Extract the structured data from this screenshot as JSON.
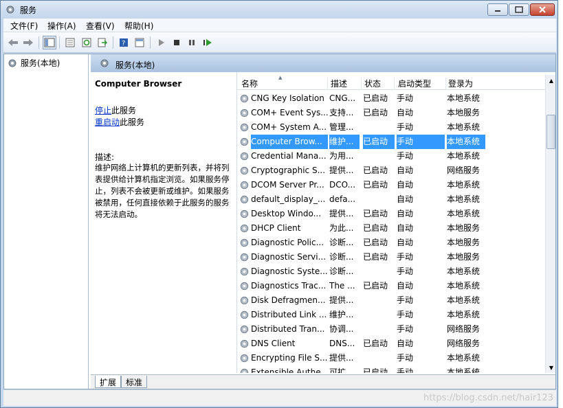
{
  "window": {
    "title": "服务"
  },
  "menu": {
    "items": [
      "文件(F)",
      "操作(A)",
      "查看(V)",
      "帮助(H)"
    ]
  },
  "tree": {
    "item": "服务(本地)"
  },
  "pane": {
    "header": "服务(本地)"
  },
  "detail": {
    "service_title": "Computer Browser",
    "stop_link": "停止",
    "stop_suffix": "此服务",
    "restart_link": "重启动",
    "restart_suffix": "此服务",
    "desc_label": "描述:",
    "desc_text": "维护网络上计算机的更新列表，并将列表提供给计算机指定浏览。如果服务停止，列表不会被更新或维护。如果服务被禁用，任何直接依赖于此服务的服务将无法启动。"
  },
  "columns": {
    "name": "名称",
    "desc": "描述",
    "state": "状态",
    "startup": "启动类型",
    "logon": "登录为"
  },
  "services": [
    {
      "name": "CNG Key Isolation",
      "desc": "CNG...",
      "state": "已启动",
      "startup": "手动",
      "logon": "本地系统"
    },
    {
      "name": "COM+ Event Sys...",
      "desc": "支持...",
      "state": "已启动",
      "startup": "自动",
      "logon": "本地服务"
    },
    {
      "name": "COM+ System A...",
      "desc": "管理...",
      "state": "",
      "startup": "手动",
      "logon": "本地系统"
    },
    {
      "name": "Computer Brow...",
      "desc": "维护...",
      "state": "已启动",
      "startup": "手动",
      "logon": "本地系统",
      "selected": true
    },
    {
      "name": "Credential Mana...",
      "desc": "为用...",
      "state": "",
      "startup": "手动",
      "logon": "本地系统"
    },
    {
      "name": "Cryptographic S...",
      "desc": "提供...",
      "state": "已启动",
      "startup": "自动",
      "logon": "网络服务"
    },
    {
      "name": "DCOM Server Pr...",
      "desc": "DCO...",
      "state": "已启动",
      "startup": "自动",
      "logon": "本地系统"
    },
    {
      "name": "default_display_...",
      "desc": "defa...",
      "state": "",
      "startup": "自动",
      "logon": "本地系统"
    },
    {
      "name": "Desktop Windo...",
      "desc": "提供...",
      "state": "已启动",
      "startup": "自动",
      "logon": "本地系统"
    },
    {
      "name": "DHCP Client",
      "desc": "为此...",
      "state": "已启动",
      "startup": "自动",
      "logon": "本地服务"
    },
    {
      "name": "Diagnostic Polic...",
      "desc": "诊断...",
      "state": "已启动",
      "startup": "自动",
      "logon": "本地服务"
    },
    {
      "name": "Diagnostic Servi...",
      "desc": "诊断...",
      "state": "已启动",
      "startup": "手动",
      "logon": "本地服务"
    },
    {
      "name": "Diagnostic Syste...",
      "desc": "诊断...",
      "state": "",
      "startup": "手动",
      "logon": "本地系统"
    },
    {
      "name": "Diagnostics Trac...",
      "desc": "The ...",
      "state": "已启动",
      "startup": "自动",
      "logon": "本地系统"
    },
    {
      "name": "Disk Defragmen...",
      "desc": "提供...",
      "state": "",
      "startup": "手动",
      "logon": "本地系统"
    },
    {
      "name": "Distributed Link ...",
      "desc": "维护...",
      "state": "",
      "startup": "手动",
      "logon": "本地系统"
    },
    {
      "name": "Distributed Tran...",
      "desc": "协调...",
      "state": "",
      "startup": "手动",
      "logon": "网络服务"
    },
    {
      "name": "DNS Client",
      "desc": "DNS...",
      "state": "已启动",
      "startup": "自动",
      "logon": "网络服务"
    },
    {
      "name": "Encrypting File S...",
      "desc": "提供...",
      "state": "",
      "startup": "手动",
      "logon": "本地系统"
    },
    {
      "name": "Extensible Authe...",
      "desc": "可扩...",
      "state": "已启动",
      "startup": "手动",
      "logon": "本地系统"
    }
  ],
  "tabs": [
    "扩展",
    "标准"
  ],
  "watermark": "https://blog.csdn.net/hair123"
}
